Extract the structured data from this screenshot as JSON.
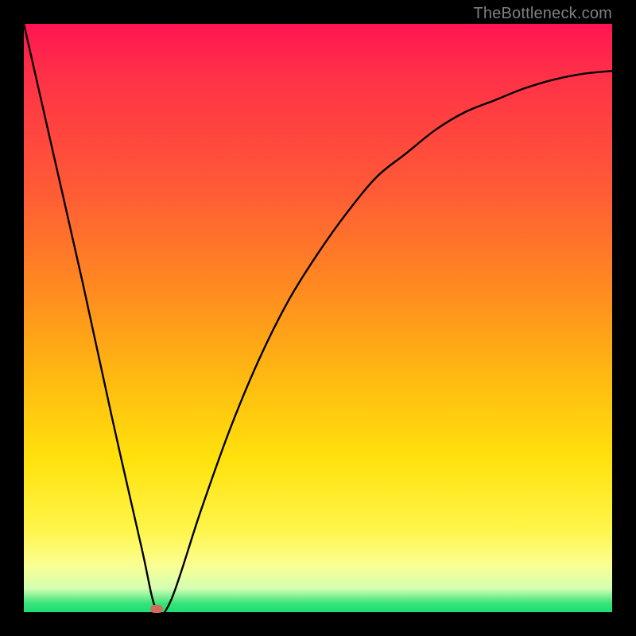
{
  "attribution": "TheBottleneck.com",
  "chart_data": {
    "type": "line",
    "title": "",
    "xlabel": "",
    "ylabel": "",
    "xlim": [
      0,
      100
    ],
    "ylim": [
      0,
      100
    ],
    "grid": false,
    "legend": false,
    "series": [
      {
        "name": "bottleneck-curve",
        "x": [
          0,
          5,
          10,
          15,
          20,
          22.5,
          25,
          30,
          35,
          40,
          45,
          50,
          55,
          60,
          65,
          70,
          75,
          80,
          85,
          90,
          95,
          100
        ],
        "y": [
          100,
          78,
          56,
          33,
          11,
          0.5,
          2,
          17,
          31,
          43,
          53,
          61,
          68,
          74,
          78,
          82,
          85,
          87,
          89,
          90.5,
          91.5,
          92
        ]
      }
    ],
    "marker": {
      "x": 22.5,
      "y": 0.5,
      "color": "#d46a5e"
    },
    "background_gradient": {
      "direction": "top-to-bottom",
      "stops": [
        {
          "pos": 0,
          "color": "#ff1452"
        },
        {
          "pos": 0.45,
          "color": "#ff8a20"
        },
        {
          "pos": 0.74,
          "color": "#ffe20c"
        },
        {
          "pos": 0.92,
          "color": "#fbff92"
        },
        {
          "pos": 1.0,
          "color": "#19df72"
        }
      ]
    }
  }
}
